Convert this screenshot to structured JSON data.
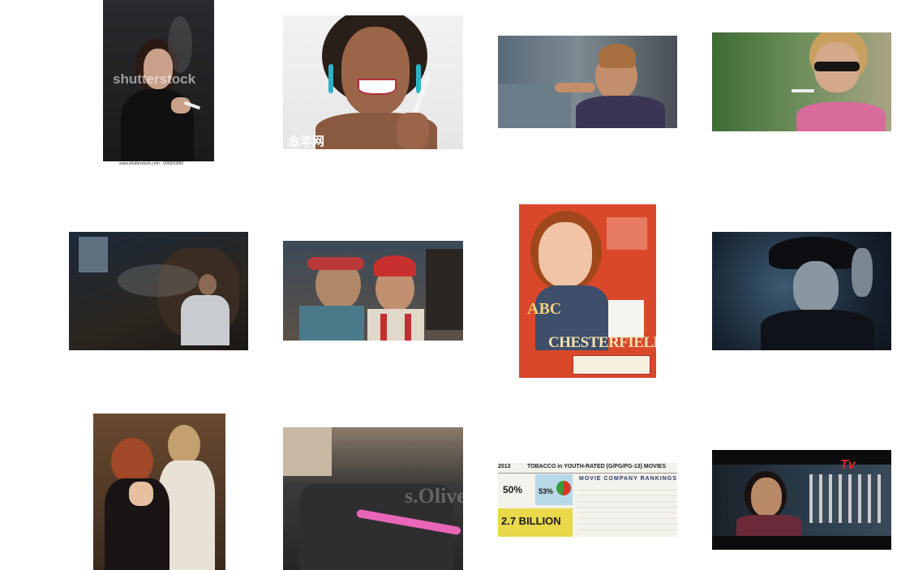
{
  "tiles": [
    {
      "name": "image-result-1",
      "watermark": "shutterstock",
      "caption": "www.shutterstock.com · 000000000"
    },
    {
      "name": "image-result-2",
      "watermark": "金羊网"
    },
    {
      "name": "image-result-3"
    },
    {
      "name": "image-result-4"
    },
    {
      "name": "image-result-5"
    },
    {
      "name": "image-result-6"
    },
    {
      "name": "image-result-7",
      "ad": {
        "brand_prefix": "ABC",
        "brand": "CHESTERFIELD"
      }
    },
    {
      "name": "image-result-8"
    },
    {
      "name": "image-result-9"
    },
    {
      "name": "image-result-10",
      "watermark": "s.Oliver"
    },
    {
      "name": "image-result-11",
      "infographic": {
        "year": "2013",
        "headline": "TOBACCO in YOUTH-RATED (G/PG/PG-13) MOVIES",
        "stat_percent": "50%",
        "stat_percent_2": "53%",
        "big_number": "2.7 BILLION",
        "rankings_title": "MOVIE COMPANY RANKINGS"
      }
    },
    {
      "name": "image-result-12",
      "logo": "Tv"
    }
  ],
  "colors": {
    "background": "#ffffff",
    "ad_red": "#d9482b",
    "info_green": "#3a9a3a",
    "info_red": "#d23a2a"
  }
}
